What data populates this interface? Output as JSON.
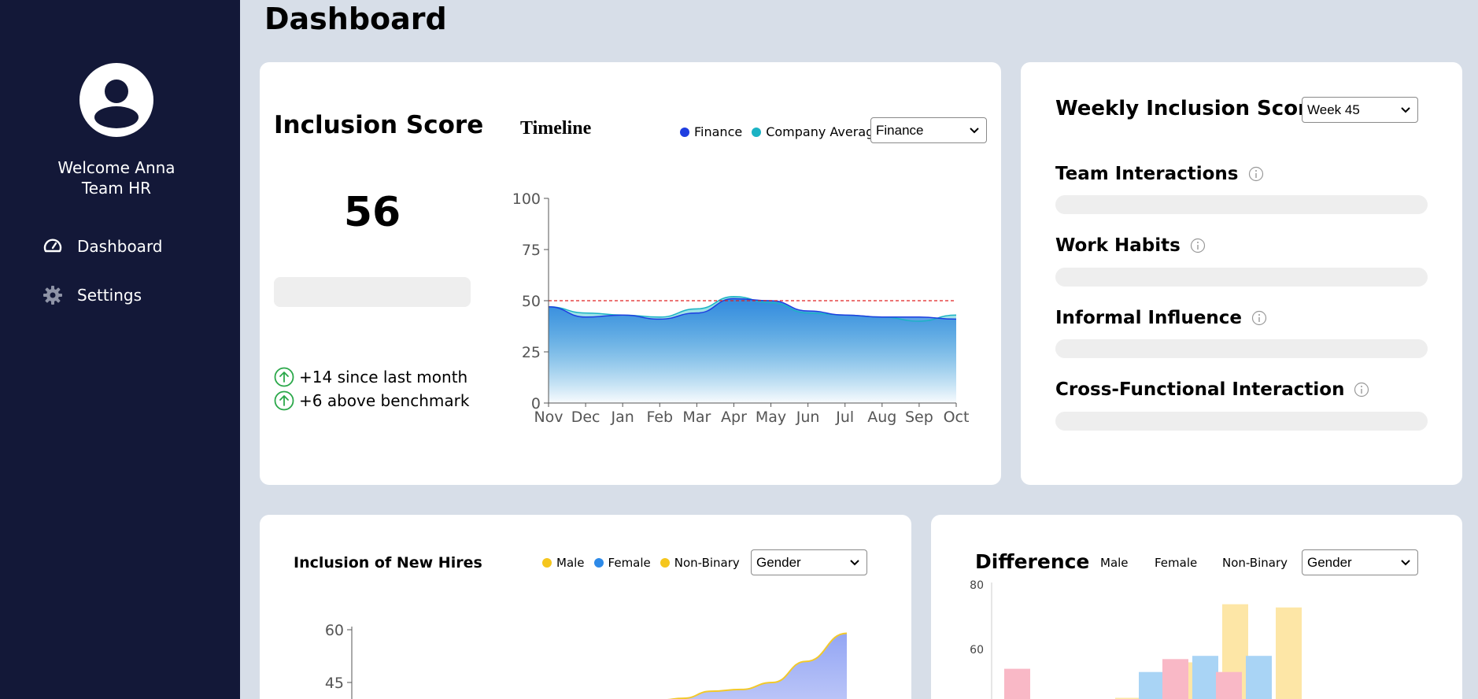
{
  "page": {
    "title": "Dashboard"
  },
  "sidebar": {
    "welcome_line1": "Welcome Anna",
    "welcome_line2": "Team HR",
    "items": [
      {
        "label": "Dashboard",
        "icon": "gauge-icon"
      },
      {
        "label": "Settings",
        "icon": "gear-icon"
      }
    ]
  },
  "inclusion_score": {
    "title": "Inclusion Score",
    "value": "56",
    "deltas": [
      "+14 since last month",
      "+6 above benchmark"
    ]
  },
  "timeline": {
    "title": "Timeline",
    "legend": [
      "Finance",
      "Company Average"
    ],
    "select_value": "Finance"
  },
  "weekly": {
    "title": "Weekly Inclusion Score",
    "select_value": "Week 45",
    "metrics": [
      "Team Interactions",
      "Work Habits",
      "Informal Influence",
      "Cross-Functional Interaction"
    ]
  },
  "new_hires": {
    "title": "Inclusion of New Hires",
    "legend": [
      "Male",
      "Female",
      "Non-Binary"
    ],
    "select_value": "Gender"
  },
  "difference": {
    "title": "Difference",
    "legend": [
      "Male",
      "Female",
      "Non-Binary"
    ],
    "select_value": "Gender"
  },
  "colors": {
    "sidebar": "#131838",
    "finance": "#1f3ee0",
    "company_average": "#1bb3c4",
    "male": "#f5c61d",
    "female": "#2d8ae8",
    "non_binary": "#f5c61d",
    "benchmark": "#e02020"
  },
  "chart_data": [
    {
      "type": "area",
      "title": "Timeline",
      "categories": [
        "Nov",
        "Dec",
        "Jan",
        "Feb",
        "Mar",
        "Apr",
        "May",
        "Jun",
        "Jul",
        "Aug",
        "Sep",
        "Oct"
      ],
      "series": [
        {
          "name": "Finance",
          "values": [
            47,
            42,
            43,
            41,
            44,
            51,
            50,
            45,
            43,
            42,
            42,
            41
          ]
        },
        {
          "name": "Company Average",
          "values": [
            47,
            44,
            43,
            42,
            46,
            52,
            49,
            44,
            43,
            42,
            40,
            43
          ]
        }
      ],
      "benchmark": 50,
      "ylim": [
        0,
        100
      ],
      "yticks": [
        0,
        25,
        50,
        75,
        100
      ]
    },
    {
      "type": "area",
      "title": "Inclusion of New Hires",
      "yticks": [
        45,
        60
      ],
      "series": [
        {
          "name": "Non-Binary",
          "x": [
            0.0,
            0.12,
            0.27,
            0.43,
            0.6,
            0.78,
            1.0
          ],
          "values": [
            40,
            40.5,
            42.5,
            43,
            45,
            51,
            59
          ]
        }
      ]
    },
    {
      "type": "bar",
      "title": "Difference",
      "yticks": [
        60,
        80
      ],
      "groups": [
        {
          "values": [
            54,
            null,
            null
          ],
          "colors": [
            "#f9b8c6",
            "#a9d4f5",
            "#fde6a6"
          ]
        },
        {
          "values": [
            null,
            null,
            45
          ],
          "colors": [
            "#f9b8c6",
            "#a9d4f5",
            "#fde6a6"
          ]
        },
        {
          "values": [
            null,
            53,
            56
          ],
          "colors": [
            "#f9b8c6",
            "#a9d4f5",
            "#fde6a6"
          ]
        },
        {
          "values": [
            57,
            58,
            74
          ],
          "colors": [
            "#f9b8c6",
            "#a9d4f5",
            "#fde6a6"
          ]
        },
        {
          "values": [
            53,
            58,
            73
          ],
          "colors": [
            "#f9b8c6",
            "#a9d4f5",
            "#fde6a6"
          ]
        }
      ]
    }
  ]
}
